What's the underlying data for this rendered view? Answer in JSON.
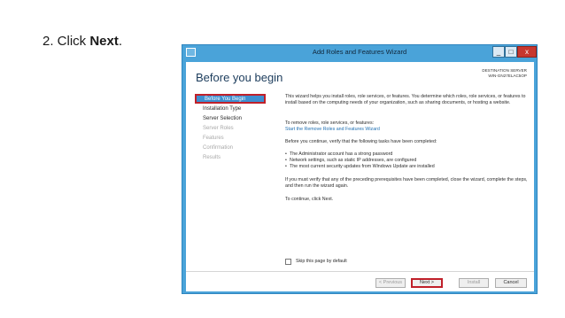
{
  "caption": {
    "prefix": "2. Click ",
    "bold": "Next",
    "suffix": "."
  },
  "window": {
    "title": "Add Roles and Features Wizard",
    "controls": {
      "minimize": "_",
      "maximize": "□",
      "close": "x"
    }
  },
  "header": {
    "title": "Before you begin",
    "destination_label": "DESTINATION SERVER",
    "destination_server": "WIN-GN27ELAC5OP"
  },
  "nav": {
    "items": [
      {
        "label": "Before You Begin",
        "state": "active"
      },
      {
        "label": "Installation Type",
        "state": "enabled"
      },
      {
        "label": "Server Selection",
        "state": "enabled"
      },
      {
        "label": "Server Roles",
        "state": "disabled"
      },
      {
        "label": "Features",
        "state": "disabled"
      },
      {
        "label": "Confirmation",
        "state": "disabled"
      },
      {
        "label": "Results",
        "state": "disabled"
      }
    ]
  },
  "content": {
    "intro": "This wizard helps you install roles, role services, or features. You determine which roles, role services, or features to install based on the computing needs of your organization, such as sharing documents, or hosting a website.",
    "remove_text": "To remove roles, role services, or features:",
    "remove_link": "Start the Remove Roles and Features Wizard",
    "verify_text": "Before you continue, verify that the following tasks have been completed:",
    "bullets": [
      "The Administrator account has a strong password",
      "Network settings, such as static IP addresses, are configured",
      "The most current security updates from Windows Update are installed"
    ],
    "prereq_text": "If you must verify that any of the preceding prerequisites have been completed, close the wizard, complete the steps, and then run the wizard again.",
    "continue_text": "To continue, click Next."
  },
  "skip": {
    "label": "Skip this page by default",
    "checked": false
  },
  "footer": {
    "previous_label": "< Previous",
    "next_label": "Next >",
    "install_label": "Install",
    "cancel_label": "Cancel"
  },
  "colors": {
    "titlebar": "#4aa3d9",
    "nav_active": "#3d8fd0",
    "highlight": "#c0202a",
    "link": "#1f6fb2"
  }
}
